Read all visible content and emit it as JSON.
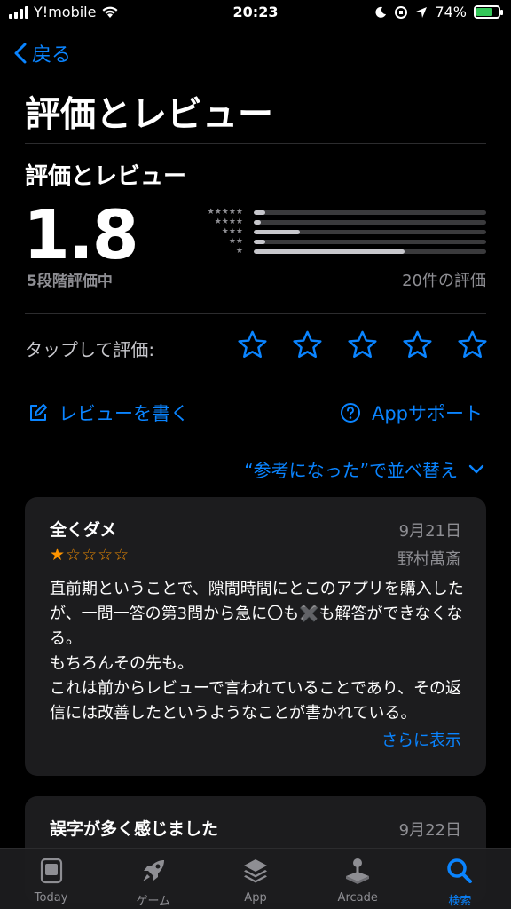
{
  "status_bar": {
    "carrier": "Y!mobile",
    "time": "20:23",
    "battery": "74%"
  },
  "nav": {
    "back_label": "戻る"
  },
  "page_title": "評価とレビュー",
  "ratings": {
    "section_title": "評価とレビュー",
    "average": "1.8",
    "out_of": "5段階評価中",
    "count_label": "20件の評価",
    "distribution": [
      {
        "stars": "★★★★★",
        "fraction": 0.05
      },
      {
        "stars": "★★★★",
        "fraction": 0.03
      },
      {
        "stars": "★★★",
        "fraction": 0.2
      },
      {
        "stars": "★★",
        "fraction": 0.05
      },
      {
        "stars": "★",
        "fraction": 0.65
      }
    ]
  },
  "tap_to_rate": {
    "label": "タップして評価:"
  },
  "actions": {
    "write_review": "レビューを書く",
    "app_support": "Appサポート"
  },
  "sort": {
    "label": "“参考になった”で並べ替え"
  },
  "reviews": [
    {
      "title": "全くダメ",
      "date": "9月21日",
      "author": "野村萬斎",
      "stars_on": "★",
      "stars_off": "☆☆☆☆",
      "body": "直前期ということで、隙間時間にとこのアプリを購入したが、一問一答の第3問から急に〇も✖️も解答ができなくなる。\nもちろんその先も。\nこれは前からレビューで言われていることであり、その返信には改善したというようなことが書かれている。",
      "more_label": "さらに表示"
    },
    {
      "title": "誤字が多く感じました",
      "date": "9月22日"
    }
  ],
  "tab_bar": [
    {
      "label": "Today",
      "icon": "today-icon"
    },
    {
      "label": "ゲーム",
      "icon": "rocket-icon"
    },
    {
      "label": "App",
      "icon": "layers-icon"
    },
    {
      "label": "Arcade",
      "icon": "joystick-icon"
    },
    {
      "label": "検索",
      "icon": "search-icon",
      "active": true
    }
  ],
  "colors": {
    "accent": "#0a84ff",
    "star": "#ff9500",
    "card": "#1c1c1e",
    "battery": "#34c759"
  }
}
